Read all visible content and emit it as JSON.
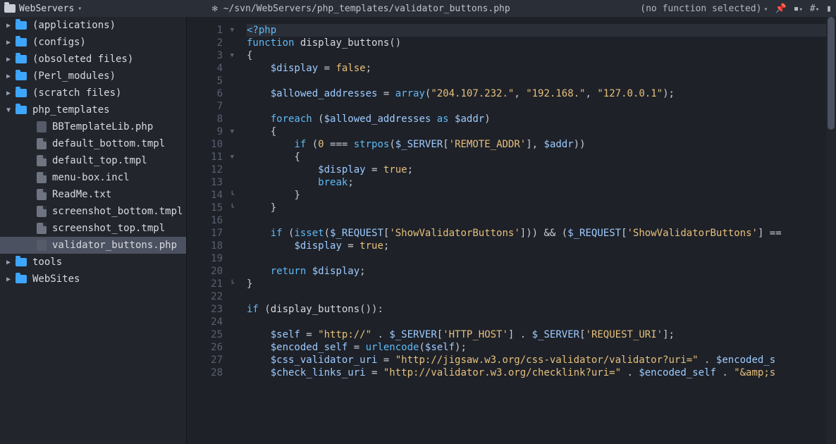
{
  "topbar": {
    "project_name": "WebServers",
    "filepath": "~/svn/WebServers/php_templates/validator_buttons.php",
    "function_selector": "(no function selected)",
    "hash_label": "#"
  },
  "sidebar": {
    "items": [
      {
        "expand": "▶",
        "icon": "folder",
        "label": "(applications)",
        "level": 0
      },
      {
        "expand": "▶",
        "icon": "folder",
        "label": "(configs)",
        "level": 0
      },
      {
        "expand": "▶",
        "icon": "folder",
        "label": "(obsoleted files)",
        "level": 0
      },
      {
        "expand": "▶",
        "icon": "folder",
        "label": "(Perl_modules)",
        "level": 0
      },
      {
        "expand": "▶",
        "icon": "folder",
        "label": "(scratch files)",
        "level": 0
      },
      {
        "expand": "▼",
        "icon": "folder",
        "label": "php_templates",
        "level": 0
      },
      {
        "expand": "",
        "icon": "php",
        "label": "BBTemplateLib.php",
        "level": 1
      },
      {
        "expand": "",
        "icon": "doc",
        "label": "default_bottom.tmpl",
        "level": 1
      },
      {
        "expand": "",
        "icon": "doc",
        "label": "default_top.tmpl",
        "level": 1
      },
      {
        "expand": "",
        "icon": "doc",
        "label": "menu-box.incl",
        "level": 1
      },
      {
        "expand": "",
        "icon": "doc",
        "label": "ReadMe.txt",
        "level": 1
      },
      {
        "expand": "",
        "icon": "doc",
        "label": "screenshot_bottom.tmpl",
        "level": 1
      },
      {
        "expand": "",
        "icon": "doc",
        "label": "screenshot_top.tmpl",
        "level": 1
      },
      {
        "expand": "",
        "icon": "php",
        "label": "validator_buttons.php",
        "level": 1,
        "selected": true
      },
      {
        "expand": "▶",
        "icon": "folder",
        "label": "tools",
        "level": 0
      },
      {
        "expand": "▶",
        "icon": "folder",
        "label": "WebSites",
        "level": 0
      }
    ]
  },
  "editor": {
    "lines": [
      {
        "n": 1,
        "fold": "▼",
        "tokens": [
          [
            "kw",
            "<?php"
          ]
        ],
        "current": true
      },
      {
        "n": 2,
        "fold": "",
        "tokens": [
          [
            "kw",
            "function"
          ],
          [
            "fn",
            " display_buttons"
          ],
          [
            "punct",
            "()"
          ]
        ]
      },
      {
        "n": 3,
        "fold": "▼",
        "tokens": [
          [
            "punct",
            "{"
          ]
        ]
      },
      {
        "n": 4,
        "fold": "",
        "tokens": [
          [
            "op",
            "    "
          ],
          [
            "var",
            "$display"
          ],
          [
            "op",
            " = "
          ],
          [
            "lit",
            "false"
          ],
          [
            "punct",
            ";"
          ]
        ]
      },
      {
        "n": 5,
        "fold": "",
        "tokens": []
      },
      {
        "n": 6,
        "fold": "",
        "tokens": [
          [
            "op",
            "    "
          ],
          [
            "var",
            "$allowed_addresses"
          ],
          [
            "op",
            " = "
          ],
          [
            "call",
            "array"
          ],
          [
            "punct",
            "("
          ],
          [
            "str",
            "\"204.107.232.\""
          ],
          [
            "punct",
            ", "
          ],
          [
            "str",
            "\"192.168.\""
          ],
          [
            "punct",
            ", "
          ],
          [
            "str",
            "\"127.0.0.1\""
          ],
          [
            "punct",
            ");"
          ]
        ]
      },
      {
        "n": 7,
        "fold": "",
        "tokens": []
      },
      {
        "n": 8,
        "fold": "",
        "tokens": [
          [
            "op",
            "    "
          ],
          [
            "kw",
            "foreach"
          ],
          [
            "punct",
            " ("
          ],
          [
            "var",
            "$allowed_addresses"
          ],
          [
            "kw",
            " as "
          ],
          [
            "var",
            "$addr"
          ],
          [
            "punct",
            ")"
          ]
        ]
      },
      {
        "n": 9,
        "fold": "▼",
        "tokens": [
          [
            "op",
            "    "
          ],
          [
            "punct",
            "{"
          ]
        ]
      },
      {
        "n": 10,
        "fold": "",
        "tokens": [
          [
            "op",
            "        "
          ],
          [
            "kw",
            "if"
          ],
          [
            "punct",
            " ("
          ],
          [
            "num",
            "0"
          ],
          [
            "op",
            " === "
          ],
          [
            "call",
            "strpos"
          ],
          [
            "punct",
            "("
          ],
          [
            "var",
            "$_SERVER"
          ],
          [
            "punct",
            "["
          ],
          [
            "str",
            "'REMOTE_ADDR'"
          ],
          [
            "punct",
            "], "
          ],
          [
            "var",
            "$addr"
          ],
          [
            "punct",
            "))"
          ]
        ]
      },
      {
        "n": 11,
        "fold": "▼",
        "tokens": [
          [
            "op",
            "        "
          ],
          [
            "punct",
            "{"
          ]
        ]
      },
      {
        "n": 12,
        "fold": "",
        "tokens": [
          [
            "op",
            "            "
          ],
          [
            "var",
            "$display"
          ],
          [
            "op",
            " = "
          ],
          [
            "lit",
            "true"
          ],
          [
            "punct",
            ";"
          ]
        ]
      },
      {
        "n": 13,
        "fold": "",
        "tokens": [
          [
            "op",
            "            "
          ],
          [
            "kw",
            "break"
          ],
          [
            "punct",
            ";"
          ]
        ]
      },
      {
        "n": 14,
        "fold": "┗",
        "tokens": [
          [
            "op",
            "        "
          ],
          [
            "punct",
            "}"
          ]
        ]
      },
      {
        "n": 15,
        "fold": "┗",
        "tokens": [
          [
            "op",
            "    "
          ],
          [
            "punct",
            "}"
          ]
        ]
      },
      {
        "n": 16,
        "fold": "",
        "tokens": []
      },
      {
        "n": 17,
        "fold": "",
        "tokens": [
          [
            "op",
            "    "
          ],
          [
            "kw",
            "if"
          ],
          [
            "punct",
            " ("
          ],
          [
            "call",
            "isset"
          ],
          [
            "punct",
            "("
          ],
          [
            "var",
            "$_REQUEST"
          ],
          [
            "punct",
            "["
          ],
          [
            "str",
            "'ShowValidatorButtons'"
          ],
          [
            "punct",
            "])) && ("
          ],
          [
            "var",
            "$_REQUEST"
          ],
          [
            "punct",
            "["
          ],
          [
            "str",
            "'ShowValidatorButtons'"
          ],
          [
            "punct",
            "] =="
          ]
        ]
      },
      {
        "n": 18,
        "fold": "",
        "tokens": [
          [
            "op",
            "        "
          ],
          [
            "var",
            "$display"
          ],
          [
            "op",
            " = "
          ],
          [
            "lit",
            "true"
          ],
          [
            "punct",
            ";"
          ]
        ]
      },
      {
        "n": 19,
        "fold": "",
        "tokens": []
      },
      {
        "n": 20,
        "fold": "",
        "tokens": [
          [
            "op",
            "    "
          ],
          [
            "kw",
            "return"
          ],
          [
            "op",
            " "
          ],
          [
            "var",
            "$display"
          ],
          [
            "punct",
            ";"
          ]
        ]
      },
      {
        "n": 21,
        "fold": "┗",
        "tokens": [
          [
            "punct",
            "}"
          ]
        ]
      },
      {
        "n": 22,
        "fold": "",
        "tokens": []
      },
      {
        "n": 23,
        "fold": "",
        "tokens": [
          [
            "kw",
            "if"
          ],
          [
            "punct",
            " ("
          ],
          [
            "fn",
            "display_buttons"
          ],
          [
            "punct",
            "()):"
          ]
        ]
      },
      {
        "n": 24,
        "fold": "",
        "tokens": []
      },
      {
        "n": 25,
        "fold": "",
        "tokens": [
          [
            "op",
            "    "
          ],
          [
            "var",
            "$self"
          ],
          [
            "op",
            " = "
          ],
          [
            "str",
            "\"http://\""
          ],
          [
            "op",
            " . "
          ],
          [
            "var",
            "$_SERVER"
          ],
          [
            "punct",
            "["
          ],
          [
            "str",
            "'HTTP_HOST'"
          ],
          [
            "punct",
            "] . "
          ],
          [
            "var",
            "$_SERVER"
          ],
          [
            "punct",
            "["
          ],
          [
            "str",
            "'REQUEST_URI'"
          ],
          [
            "punct",
            "];"
          ]
        ]
      },
      {
        "n": 26,
        "fold": "",
        "tokens": [
          [
            "op",
            "    "
          ],
          [
            "var",
            "$encoded_self"
          ],
          [
            "op",
            " = "
          ],
          [
            "call",
            "urlencode"
          ],
          [
            "punct",
            "("
          ],
          [
            "var",
            "$self"
          ],
          [
            "punct",
            ");"
          ]
        ]
      },
      {
        "n": 27,
        "fold": "",
        "tokens": [
          [
            "op",
            "    "
          ],
          [
            "var",
            "$css_validator_uri"
          ],
          [
            "op",
            " = "
          ],
          [
            "str",
            "\"http://jigsaw.w3.org/css-validator/validator?uri=\""
          ],
          [
            "op",
            " . "
          ],
          [
            "var",
            "$encoded_s"
          ]
        ]
      },
      {
        "n": 28,
        "fold": "",
        "tokens": [
          [
            "op",
            "    "
          ],
          [
            "var",
            "$check_links_uri"
          ],
          [
            "op",
            " = "
          ],
          [
            "str",
            "\"http://validator.w3.org/checklink?uri=\""
          ],
          [
            "op",
            " . "
          ],
          [
            "var",
            "$encoded_self"
          ],
          [
            "op",
            " . "
          ],
          [
            "str",
            "\"&amp;s"
          ]
        ]
      }
    ]
  }
}
